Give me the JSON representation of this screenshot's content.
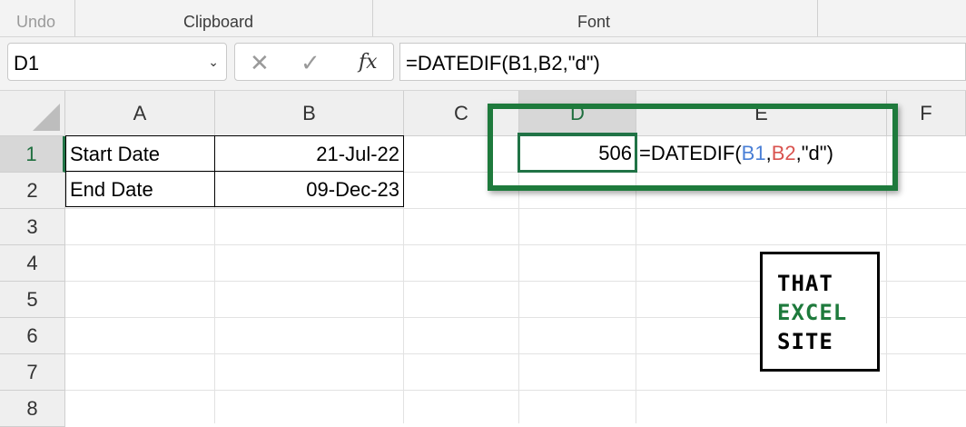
{
  "ribbon": {
    "undo_label": "Undo",
    "clipboard_label": "Clipboard",
    "font_label": "Font"
  },
  "formula_bar": {
    "name_box": "D1",
    "cancel_icon": "close-icon",
    "enter_icon": "check-icon",
    "fx_label": "fx",
    "formula": "=DATEDIF(B1,B2,\"d\")"
  },
  "columns": [
    "A",
    "B",
    "C",
    "D",
    "E",
    "F"
  ],
  "rows": [
    "1",
    "2",
    "3",
    "4",
    "5",
    "6",
    "7",
    "8"
  ],
  "cells": {
    "A1": "Start Date",
    "B1": "21-Jul-22",
    "A2": "End Date",
    "B2": "09-Dec-23",
    "D1": "506",
    "E1": {
      "prefix": "=DATEDIF(",
      "ref1": "B1",
      "comma1": ",",
      "ref2": "B2",
      "suffix": ",\"d\")"
    }
  },
  "logo": {
    "line1": "THAT",
    "line2": "EXCEL",
    "line3": "SITE"
  },
  "colors": {
    "accent_green": "#217346",
    "highlight_green": "#1e7a3c",
    "ref_blue": "#4a7fd6",
    "ref_red": "#d9534f"
  }
}
